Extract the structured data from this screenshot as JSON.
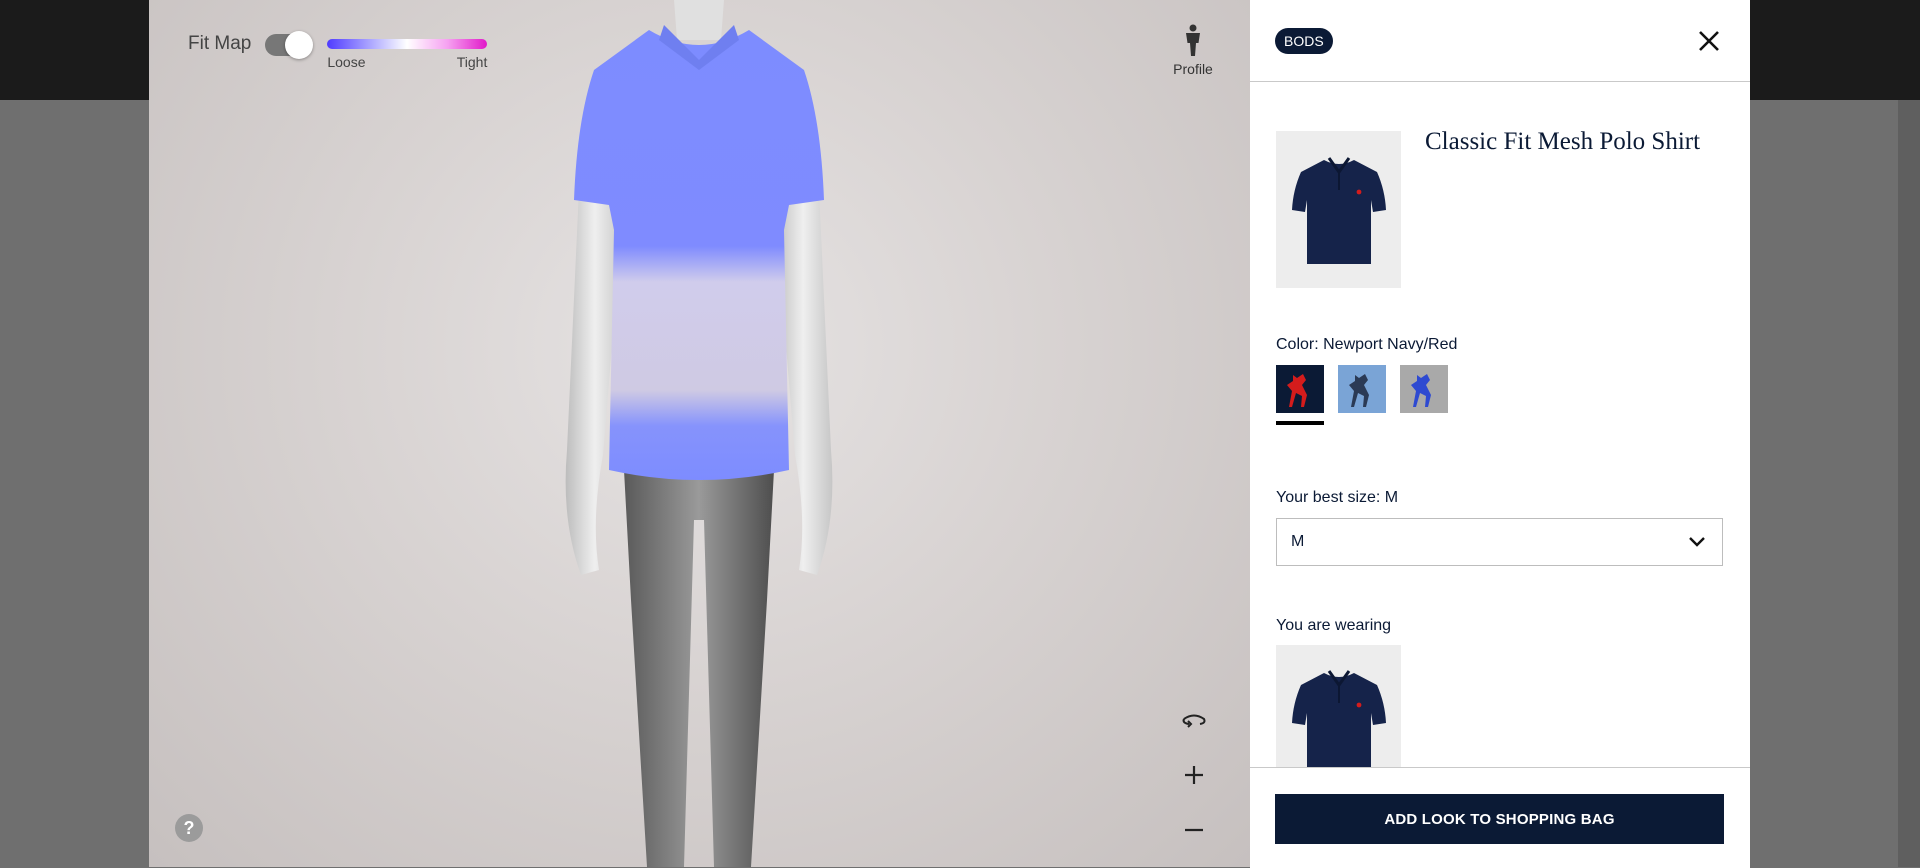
{
  "viewer": {
    "fit_map_label": "Fit Map",
    "fit_map_enabled": true,
    "scale_loose": "Loose",
    "scale_tight": "Tight",
    "profile_label": "Profile",
    "help_label": "?"
  },
  "panel": {
    "brand_badge": "BODS",
    "product_title": "Classic Fit Mesh Polo Shirt",
    "color_label": "Color: Newport Navy/Red",
    "swatches": [
      {
        "name": "Newport Navy/Red",
        "bg": "#0b1a35",
        "logo": "#d41c1c",
        "selected": true
      },
      {
        "name": "Light Blue/Navy",
        "bg": "#7aa4d6",
        "logo": "#2b3a55",
        "selected": false
      },
      {
        "name": "Grey/Blue",
        "bg": "#a9a9a9",
        "logo": "#2e4ad1",
        "selected": false
      }
    ],
    "best_size_label": "Your best size: M",
    "size_value": "M",
    "wearing_label": "You are wearing",
    "add_button": "ADD LOOK TO SHOPPING BAG"
  },
  "colors": {
    "navy": "#0b1a35",
    "fit_loose": "#4f3bff",
    "fit_tight": "#e119c9"
  }
}
